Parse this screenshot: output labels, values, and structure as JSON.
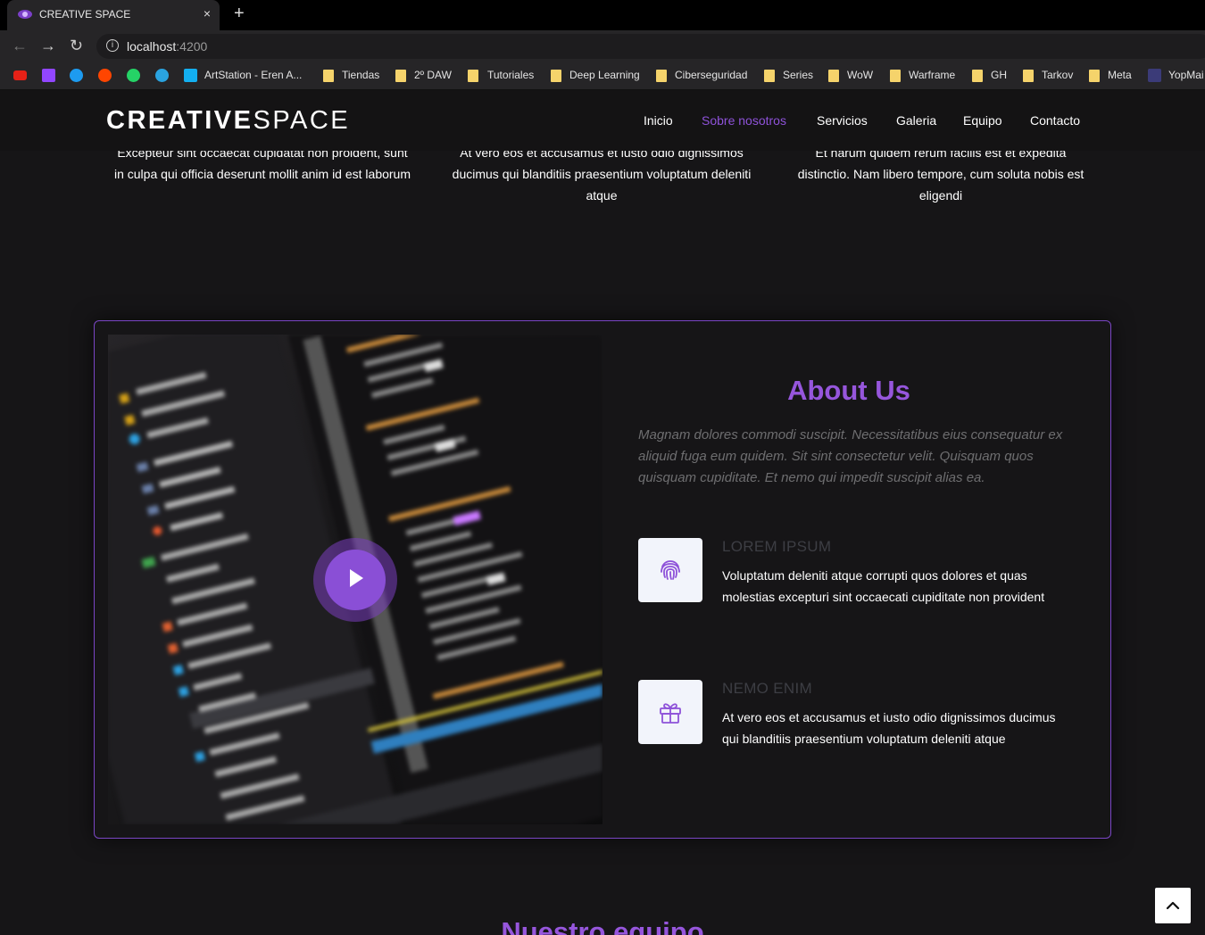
{
  "browser": {
    "tab_title": "CREATIVE SPACE",
    "tab_close": "×",
    "new_tab": "+",
    "back": "←",
    "forward": "→",
    "reload": "↻",
    "info": "i",
    "url_host": "localhost",
    "url_port": ":4200",
    "bookmarks": [
      {
        "label": "ArtStation - Eren A..."
      },
      {
        "label": "Tiendas"
      },
      {
        "label": "2º DAW"
      },
      {
        "label": "Tutoriales"
      },
      {
        "label": "Deep Learning"
      },
      {
        "label": "Ciberseguridad"
      },
      {
        "label": "Series"
      },
      {
        "label": "WoW"
      },
      {
        "label": "Warframe"
      },
      {
        "label": "GH"
      },
      {
        "label": "Tarkov"
      },
      {
        "label": "Meta"
      },
      {
        "label": "YopMai"
      }
    ]
  },
  "site": {
    "logo_bold": "CREATIVE",
    "logo_thin": "SPACE",
    "menu": [
      "Inicio",
      "Sobre nosotros",
      "Servicios",
      "Galeria",
      "Equipo",
      "Contacto"
    ],
    "active_menu": "Sobre nosotros",
    "accent": "#8e52d9"
  },
  "features": [
    {
      "line1": "Excepteur sint occaecat cupidatat non proident, sunt",
      "rest": "in culpa qui officia deserunt mollit anim id est laborum"
    },
    {
      "line1": "At vero eos et accusamus et iusto odio dignissimos",
      "rest": "ducimus qui blanditiis praesentium voluptatum deleniti atque"
    },
    {
      "line1": "Et harum quidem rerum facilis est et expedita",
      "rest": "distinctio. Nam libero tempore, cum soluta nobis est eligendi"
    }
  ],
  "about": {
    "title": "About Us",
    "lead": "Magnam dolores commodi suscipit. Necessitatibus eius consequatur ex aliquid fuga eum quidem. Sit sint consectetur velit. Quisquam quos quisquam cupiditate. Et nemo qui impedit suscipit alias ea.",
    "items": [
      {
        "icon": "fingerprint-icon",
        "title": "LOREM IPSUM",
        "text": "Voluptatum deleniti atque corrupti quos dolores et quas molestias excepturi sint occaecati cupiditate non provident"
      },
      {
        "icon": "gift-icon",
        "title": "NEMO ENIM",
        "text": "At vero eos et accusamus et iusto odio dignissimos ducimus qui blanditiis praesentium voluptatum deleniti atque"
      }
    ]
  },
  "next_section_title": "Nuestro equipo"
}
